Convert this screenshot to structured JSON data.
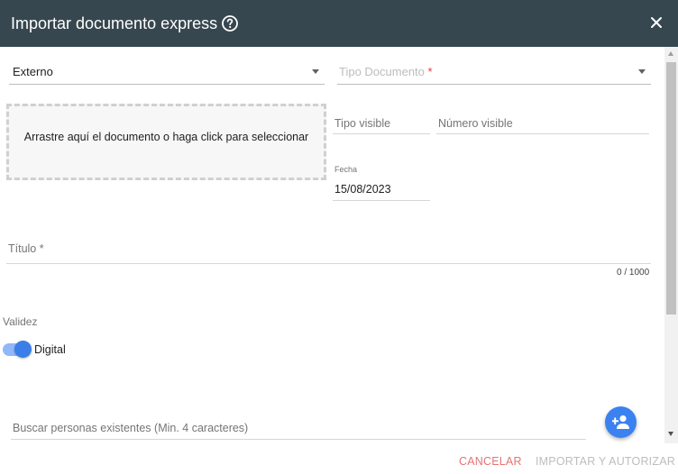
{
  "header": {
    "title": "Importar documento express",
    "bg_color": "#37474f"
  },
  "form": {
    "origin_select": {
      "value": "Externo"
    },
    "doc_type_select": {
      "placeholder": "Tipo Documento",
      "required_mark": "*"
    },
    "dropzone": {
      "text": "Arrastre aquí el documento o haga click para seleccionar"
    },
    "tipo_visible": {
      "placeholder": "Tipo visible"
    },
    "numero_visible": {
      "placeholder": "Número visible"
    },
    "fecha": {
      "label": "Fecha",
      "value": "15/08/2023"
    },
    "titulo": {
      "placeholder": "Título *",
      "counter": "0 / 1000"
    },
    "validez": {
      "label": "Validez",
      "toggle_label": "Digital",
      "toggle_on": true
    },
    "search_people": {
      "placeholder": "Buscar personas existentes (Min. 4 caracteres)"
    }
  },
  "actions": {
    "cancel_label": "CANCELAR",
    "import_label": "IMPORTAR Y AUTORIZAR"
  },
  "colors": {
    "accent": "#3b82f0",
    "cancel": "#e57373",
    "disabled": "#bdbdbd",
    "required": "#e53935"
  },
  "icons": {
    "help": "help-circle-icon",
    "close": "close-icon",
    "add_person": "person-add-icon",
    "dropdown": "chevron-down-icon"
  }
}
